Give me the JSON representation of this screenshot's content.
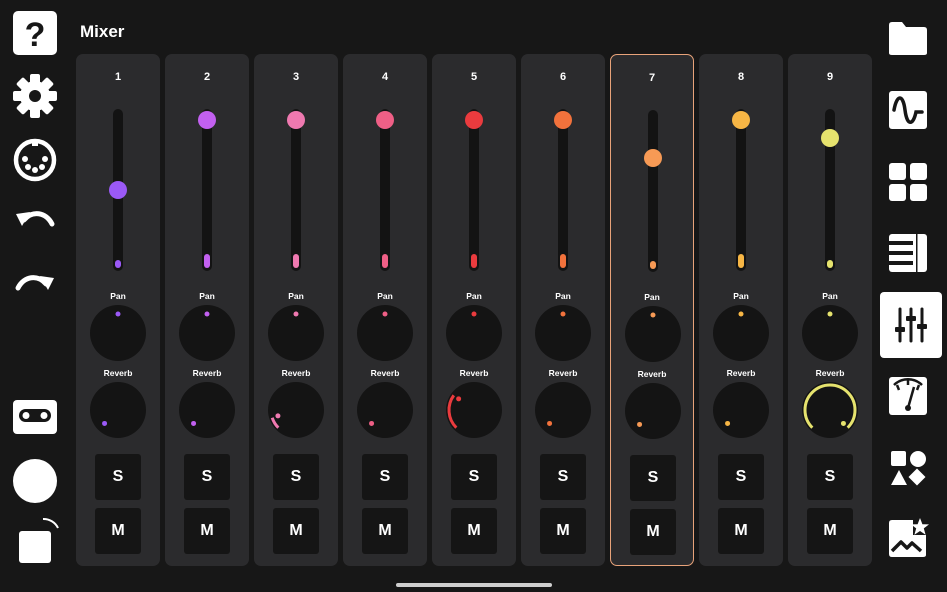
{
  "title": "Mixer",
  "labels": {
    "pan": "Pan",
    "reverb": "Reverb",
    "solo": "S",
    "mute": "M"
  },
  "selected_channel": 7,
  "left_toolbar": [
    {
      "name": "help-icon"
    },
    {
      "name": "settings-gear-icon"
    },
    {
      "name": "midi-connector-icon"
    },
    {
      "name": "undo-icon"
    },
    {
      "name": "redo-icon"
    },
    {
      "name": "cassette-tape-icon"
    },
    {
      "name": "record-button-icon"
    },
    {
      "name": "stop-button-icon"
    }
  ],
  "right_toolbar": [
    {
      "name": "folder-icon",
      "active": false
    },
    {
      "name": "waveform-icon",
      "active": false
    },
    {
      "name": "pad-grid-icon",
      "active": false
    },
    {
      "name": "piano-roll-icon",
      "active": false
    },
    {
      "name": "mixer-sliders-icon",
      "active": true
    },
    {
      "name": "metronome-icon",
      "active": false
    },
    {
      "name": "shapes-icon",
      "active": false
    },
    {
      "name": "star-image-icon",
      "active": false
    }
  ],
  "channels": [
    {
      "number": "1",
      "color": "#9b59f7",
      "volume": 0.51,
      "pan": 0.0,
      "reverb": 0.0
    },
    {
      "number": "2",
      "color": "#c260f0",
      "volume": 1.0,
      "pan": 0.0,
      "reverb": 0.0
    },
    {
      "number": "3",
      "color": "#ef79b0",
      "volume": 1.0,
      "pan": 0.0,
      "reverb": 0.1
    },
    {
      "number": "4",
      "color": "#ef5f86",
      "volume": 1.0,
      "pan": 0.0,
      "reverb": 0.0
    },
    {
      "number": "5",
      "color": "#ea3b3e",
      "volume": 1.0,
      "pan": 0.0,
      "reverb": 0.3
    },
    {
      "number": "6",
      "color": "#f2723c",
      "volume": 1.0,
      "pan": 0.0,
      "reverb": 0.0
    },
    {
      "number": "7",
      "color": "#f79a55",
      "volume": 0.74,
      "pan": 0.0,
      "reverb": 0.0
    },
    {
      "number": "8",
      "color": "#f7b645",
      "volume": 1.0,
      "pan": 0.0,
      "reverb": 0.0
    },
    {
      "number": "9",
      "color": "#e6e36e",
      "volume": 0.87,
      "pan": 0.0,
      "reverb": 1.0
    }
  ]
}
